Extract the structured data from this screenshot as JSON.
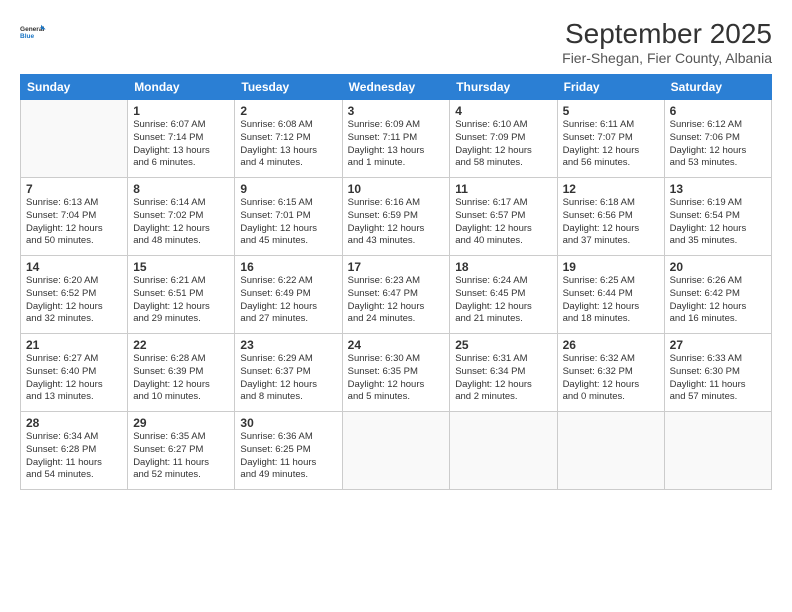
{
  "logo": {
    "line1": "General",
    "line2": "Blue"
  },
  "title": "September 2025",
  "subtitle": "Fier-Shegan, Fier County, Albania",
  "days_of_week": [
    "Sunday",
    "Monday",
    "Tuesday",
    "Wednesday",
    "Thursday",
    "Friday",
    "Saturday"
  ],
  "weeks": [
    [
      {
        "day": null,
        "info": null
      },
      {
        "day": "1",
        "info": "Sunrise: 6:07 AM\nSunset: 7:14 PM\nDaylight: 13 hours\nand 6 minutes."
      },
      {
        "day": "2",
        "info": "Sunrise: 6:08 AM\nSunset: 7:12 PM\nDaylight: 13 hours\nand 4 minutes."
      },
      {
        "day": "3",
        "info": "Sunrise: 6:09 AM\nSunset: 7:11 PM\nDaylight: 13 hours\nand 1 minute."
      },
      {
        "day": "4",
        "info": "Sunrise: 6:10 AM\nSunset: 7:09 PM\nDaylight: 12 hours\nand 58 minutes."
      },
      {
        "day": "5",
        "info": "Sunrise: 6:11 AM\nSunset: 7:07 PM\nDaylight: 12 hours\nand 56 minutes."
      },
      {
        "day": "6",
        "info": "Sunrise: 6:12 AM\nSunset: 7:06 PM\nDaylight: 12 hours\nand 53 minutes."
      }
    ],
    [
      {
        "day": "7",
        "info": "Sunrise: 6:13 AM\nSunset: 7:04 PM\nDaylight: 12 hours\nand 50 minutes."
      },
      {
        "day": "8",
        "info": "Sunrise: 6:14 AM\nSunset: 7:02 PM\nDaylight: 12 hours\nand 48 minutes."
      },
      {
        "day": "9",
        "info": "Sunrise: 6:15 AM\nSunset: 7:01 PM\nDaylight: 12 hours\nand 45 minutes."
      },
      {
        "day": "10",
        "info": "Sunrise: 6:16 AM\nSunset: 6:59 PM\nDaylight: 12 hours\nand 43 minutes."
      },
      {
        "day": "11",
        "info": "Sunrise: 6:17 AM\nSunset: 6:57 PM\nDaylight: 12 hours\nand 40 minutes."
      },
      {
        "day": "12",
        "info": "Sunrise: 6:18 AM\nSunset: 6:56 PM\nDaylight: 12 hours\nand 37 minutes."
      },
      {
        "day": "13",
        "info": "Sunrise: 6:19 AM\nSunset: 6:54 PM\nDaylight: 12 hours\nand 35 minutes."
      }
    ],
    [
      {
        "day": "14",
        "info": "Sunrise: 6:20 AM\nSunset: 6:52 PM\nDaylight: 12 hours\nand 32 minutes."
      },
      {
        "day": "15",
        "info": "Sunrise: 6:21 AM\nSunset: 6:51 PM\nDaylight: 12 hours\nand 29 minutes."
      },
      {
        "day": "16",
        "info": "Sunrise: 6:22 AM\nSunset: 6:49 PM\nDaylight: 12 hours\nand 27 minutes."
      },
      {
        "day": "17",
        "info": "Sunrise: 6:23 AM\nSunset: 6:47 PM\nDaylight: 12 hours\nand 24 minutes."
      },
      {
        "day": "18",
        "info": "Sunrise: 6:24 AM\nSunset: 6:45 PM\nDaylight: 12 hours\nand 21 minutes."
      },
      {
        "day": "19",
        "info": "Sunrise: 6:25 AM\nSunset: 6:44 PM\nDaylight: 12 hours\nand 18 minutes."
      },
      {
        "day": "20",
        "info": "Sunrise: 6:26 AM\nSunset: 6:42 PM\nDaylight: 12 hours\nand 16 minutes."
      }
    ],
    [
      {
        "day": "21",
        "info": "Sunrise: 6:27 AM\nSunset: 6:40 PM\nDaylight: 12 hours\nand 13 minutes."
      },
      {
        "day": "22",
        "info": "Sunrise: 6:28 AM\nSunset: 6:39 PM\nDaylight: 12 hours\nand 10 minutes."
      },
      {
        "day": "23",
        "info": "Sunrise: 6:29 AM\nSunset: 6:37 PM\nDaylight: 12 hours\nand 8 minutes."
      },
      {
        "day": "24",
        "info": "Sunrise: 6:30 AM\nSunset: 6:35 PM\nDaylight: 12 hours\nand 5 minutes."
      },
      {
        "day": "25",
        "info": "Sunrise: 6:31 AM\nSunset: 6:34 PM\nDaylight: 12 hours\nand 2 minutes."
      },
      {
        "day": "26",
        "info": "Sunrise: 6:32 AM\nSunset: 6:32 PM\nDaylight: 12 hours\nand 0 minutes."
      },
      {
        "day": "27",
        "info": "Sunrise: 6:33 AM\nSunset: 6:30 PM\nDaylight: 11 hours\nand 57 minutes."
      }
    ],
    [
      {
        "day": "28",
        "info": "Sunrise: 6:34 AM\nSunset: 6:28 PM\nDaylight: 11 hours\nand 54 minutes."
      },
      {
        "day": "29",
        "info": "Sunrise: 6:35 AM\nSunset: 6:27 PM\nDaylight: 11 hours\nand 52 minutes."
      },
      {
        "day": "30",
        "info": "Sunrise: 6:36 AM\nSunset: 6:25 PM\nDaylight: 11 hours\nand 49 minutes."
      },
      {
        "day": null,
        "info": null
      },
      {
        "day": null,
        "info": null
      },
      {
        "day": null,
        "info": null
      },
      {
        "day": null,
        "info": null
      }
    ]
  ]
}
